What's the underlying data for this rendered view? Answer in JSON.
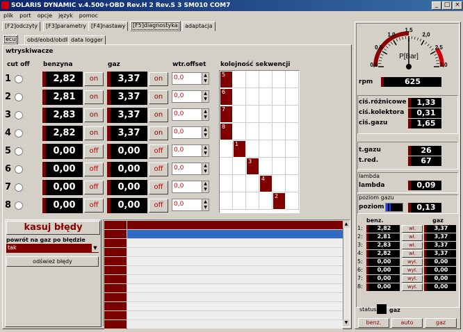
{
  "window": {
    "title": "SOLARIS DYNAMIC v.4.500+OBD Rev.H 2 Rev.S 3 SM010  COM7"
  },
  "menu": [
    "plik",
    "port",
    "opcje",
    "język",
    "pomoc"
  ],
  "main_tabs": [
    "[F2]odczyty",
    "[F3]parametry",
    "[F4]nastawy",
    "[F5]diagnostyka",
    "adaptacja"
  ],
  "sub_tabs": [
    "ecu",
    "obd/eobd/obdII",
    "data logger"
  ],
  "section_title": "wtryskiwacze",
  "headers": {
    "cutoff": "cut off",
    "benzyna": "benzyna",
    "gaz": "gaz",
    "offset": "wtr.offset",
    "seq": "kolejność sekwencji"
  },
  "injectors": [
    {
      "n": "1",
      "benz": "2,82",
      "gas": "3,37",
      "state": "on",
      "offset": "0,0"
    },
    {
      "n": "2",
      "benz": "2,81",
      "gas": "3,37",
      "state": "on",
      "offset": "0,0"
    },
    {
      "n": "3",
      "benz": "2,83",
      "gas": "3,37",
      "state": "on",
      "offset": "0,0"
    },
    {
      "n": "4",
      "benz": "2,82",
      "gas": "3,37",
      "state": "on",
      "offset": "0,0"
    },
    {
      "n": "5",
      "benz": "0,00",
      "gas": "0,00",
      "state": "off",
      "offset": "0,0"
    },
    {
      "n": "6",
      "benz": "0,00",
      "gas": "0,00",
      "state": "off",
      "offset": "0,0"
    },
    {
      "n": "7",
      "benz": "0,00",
      "gas": "0,00",
      "state": "off",
      "offset": "0,0"
    },
    {
      "n": "8",
      "benz": "0,00",
      "gas": "0,00",
      "state": "off",
      "offset": "0,0"
    }
  ],
  "sequence": [
    {
      "label": "5",
      "col": 0,
      "row": 0
    },
    {
      "label": "6",
      "col": 0,
      "row": 1
    },
    {
      "label": "7",
      "col": 0,
      "row": 2
    },
    {
      "label": "8",
      "col": 0,
      "row": 3
    },
    {
      "label": "1",
      "col": 1,
      "row": 4
    },
    {
      "label": "3",
      "col": 2,
      "row": 5
    },
    {
      "label": "4",
      "col": 3,
      "row": 6
    },
    {
      "label": "2",
      "col": 4,
      "row": 7
    }
  ],
  "errors": {
    "clear_button": "kasuj błędy",
    "return_label": "powrót na gaz po błędzie",
    "return_value": "tak",
    "refresh_button": "odśwież błędy"
  },
  "gauge": {
    "label": "P[Bar]",
    "ticks": [
      "0,0",
      "0,5",
      "1,0",
      "1,5",
      "2,0",
      "2,5",
      "3,0"
    ],
    "value_bar": 1.5
  },
  "rpm": {
    "label": "rpm",
    "value": "625"
  },
  "pressures": [
    {
      "label": "ciś.różnicowe",
      "value": "1,33"
    },
    {
      "label": "ciś.kolektora",
      "value": "0,31"
    },
    {
      "label": "ciś.gazu",
      "value": "1,65"
    }
  ],
  "temps": [
    {
      "label": "t.gazu",
      "value": "26"
    },
    {
      "label": "t.red.",
      "value": "67"
    }
  ],
  "lambda": {
    "group": "lambda",
    "label": "lambda",
    "value": "0,09"
  },
  "level": {
    "group": "poziom gazu",
    "label": "poziom",
    "value": "0,13",
    "bars": 0.3
  },
  "summary": {
    "header_benz": "benz.",
    "header_gaz": "gaz",
    "rows": [
      {
        "n": "1:",
        "benz": "2,82",
        "btn": "wł.",
        "gas": "3,37"
      },
      {
        "n": "2:",
        "benz": "2,81",
        "btn": "wł.",
        "gas": "3,37"
      },
      {
        "n": "3:",
        "benz": "2,83",
        "btn": "wł.",
        "gas": "3,37"
      },
      {
        "n": "4:",
        "benz": "2,82",
        "btn": "wł.",
        "gas": "3,37"
      },
      {
        "n": "5:",
        "benz": "0,00",
        "btn": "wył.",
        "gas": "0,00"
      },
      {
        "n": "6:",
        "benz": "0,00",
        "btn": "wył.",
        "gas": "0,00"
      },
      {
        "n": "7:",
        "benz": "0,00",
        "btn": "wył.",
        "gas": "0,00"
      },
      {
        "n": "8:",
        "benz": "0,00",
        "btn": "wył.",
        "gas": "0,00"
      }
    ]
  },
  "status": {
    "label": "status",
    "value": "gaz"
  },
  "mode_buttons": [
    "benz.",
    "auto",
    "gaz"
  ],
  "colors": {
    "dark_red": "#7a0000",
    "title_blue": "#0a246a"
  }
}
